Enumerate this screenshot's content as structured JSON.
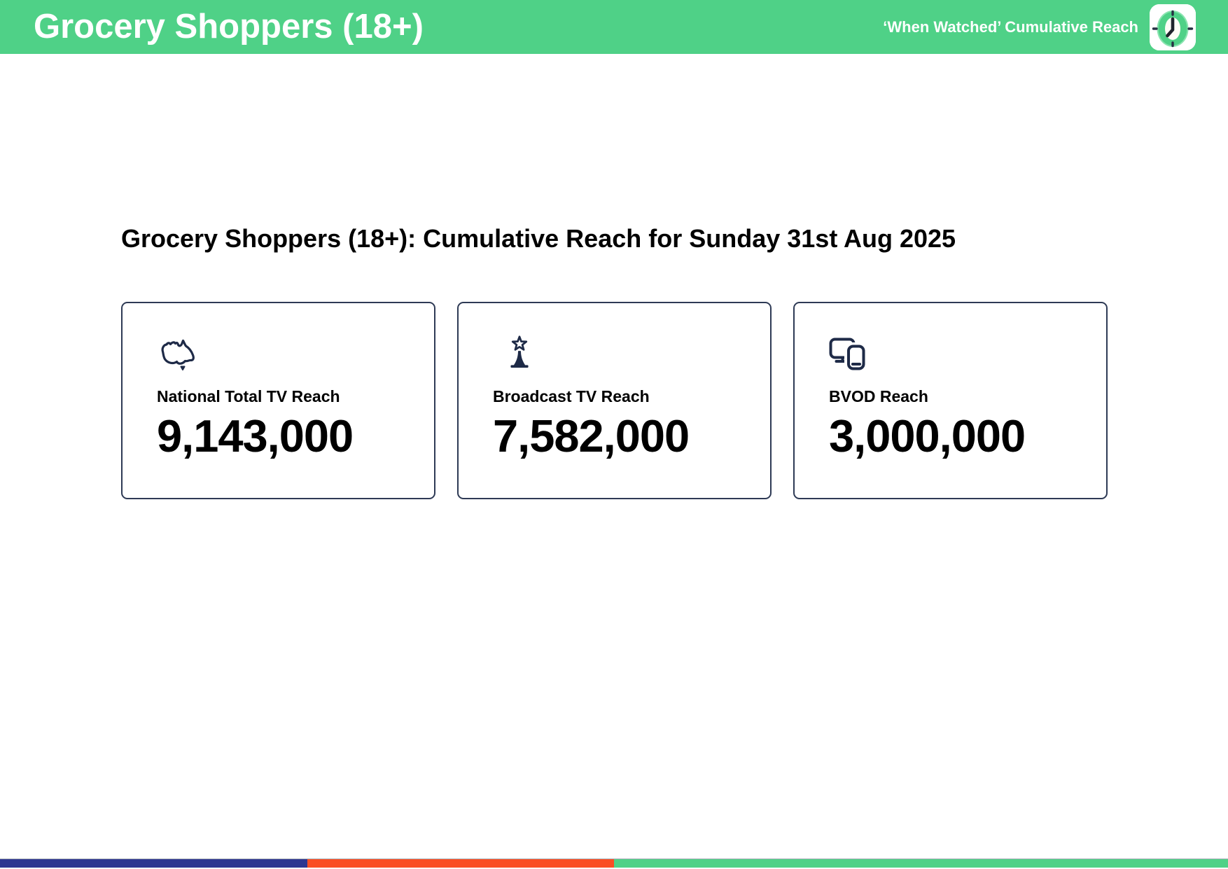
{
  "header": {
    "title": "Grocery Shoppers (18+)",
    "right_label": "‘When Watched’ Cumulative Reach",
    "bg_color": "#4fd187",
    "text_color": "#ffffff",
    "logo_icon": "clock-logo-icon"
  },
  "main": {
    "heading": "Grocery Shoppers (18+): Cumulative Reach for Sunday 31st Aug 2025",
    "text_color": "#000000",
    "card_border_color": "#2e3a55",
    "icon_color": "#1e2a47",
    "cards": [
      {
        "icon": "australia-map-icon",
        "label": "National Total TV Reach",
        "value": "9,143,000"
      },
      {
        "icon": "broadcast-tower-icon",
        "label": "Broadcast TV Reach",
        "value": "7,582,000"
      },
      {
        "icon": "monitor-smartphone-icon",
        "label": "BVOD Reach",
        "value": "3,000,000"
      }
    ]
  },
  "footer": {
    "segments": [
      {
        "name": "navy",
        "color": "#2e3690",
        "width": "25%"
      },
      {
        "name": "orange",
        "color": "#fa4e24",
        "width": "25%"
      },
      {
        "name": "green",
        "color": "#4fd187",
        "width": "50%"
      }
    ]
  }
}
